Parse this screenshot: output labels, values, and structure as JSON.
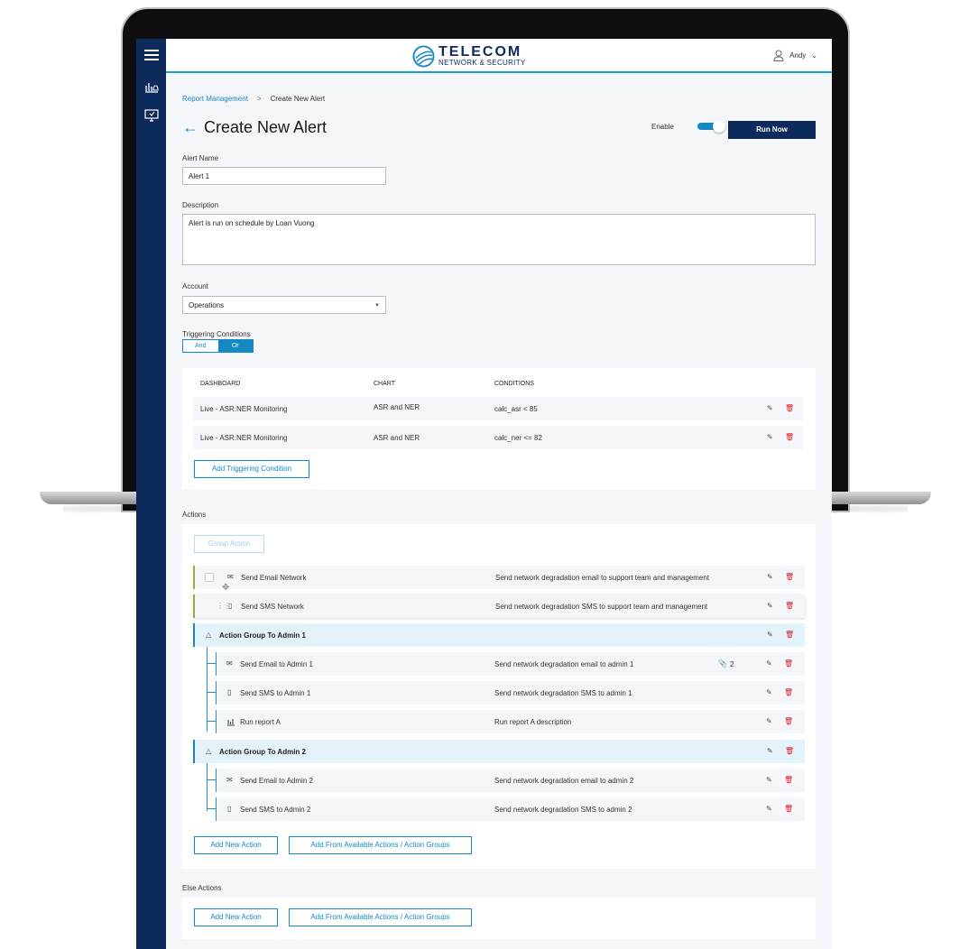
{
  "header": {
    "brand_main": "TELECOM",
    "brand_sub": "NETWORK & SECURITY",
    "user_name": "Andy"
  },
  "sidebar": {
    "items": [
      {
        "icon": "hamburger-menu-icon"
      },
      {
        "icon": "dashboard-bell-icon"
      },
      {
        "icon": "monitor-alert-icon"
      }
    ]
  },
  "breadcrumb": {
    "parent": "Report Management",
    "separator": ">",
    "current": "Create New Alert"
  },
  "page": {
    "back_icon": "arrow-left-icon",
    "title": "Create New Alert",
    "enable_label": "Enable",
    "enable_on": true,
    "run_now_label": "Run Now"
  },
  "form": {
    "alert_name_label": "Alert Name",
    "alert_name_value": "Alert 1",
    "description_label": "Description",
    "description_value": "Alert is run on schedule by Loan Vuong",
    "account_label": "Account",
    "account_value": "Operations",
    "triggering_label": "Triggering Conditions",
    "logic_and": "And",
    "logic_or": "Or",
    "logic_selected": "Or"
  },
  "conditions": {
    "headers": {
      "dashboard": "DASHBOARD",
      "chart": "CHART",
      "conditions": "CONDITIONS"
    },
    "rows": [
      {
        "dashboard": "Live - ASR:NER Monitoring",
        "chart": "ASR and NER",
        "condition": "calc_asr < 85"
      },
      {
        "dashboard": "Live - ASR:NER Monitoring",
        "chart": "ASR and NER",
        "condition": "calc_ner <= 82"
      }
    ],
    "add_label": "Add Triggering Condition"
  },
  "actions": {
    "section_label": "Actions",
    "group_action_label": "Group Action",
    "items": [
      {
        "name": "Send Email Network",
        "desc": "Send network degradation email to support team and management",
        "icon": "mail-icon"
      },
      {
        "name": "Send SMS Network",
        "desc": "Send network degradation SMS to support team and management",
        "icon": "phone-icon"
      }
    ],
    "groups": [
      {
        "name": "Action Group To Admin 1",
        "icon": "group-tree-icon",
        "children": [
          {
            "name": "Send Email to Admin 1",
            "desc": "Send network degradation email to admin 1",
            "icon": "mail-icon",
            "attachments": "2"
          },
          {
            "name": "Send SMS to Admin 1",
            "desc": "Send network degradation SMS to admin 1",
            "icon": "phone-icon"
          },
          {
            "name": "Run report A",
            "desc": "Run report A description",
            "icon": "report-chart-icon"
          }
        ]
      },
      {
        "name": "Action Group To Admin 2",
        "icon": "group-tree-icon",
        "children": [
          {
            "name": "Send Email to Admin 2",
            "desc": "Send network degradation email to admin 2",
            "icon": "mail-icon"
          },
          {
            "name": "Send SMS to Admin 2",
            "desc": "Send network degradation SMS to admin 2",
            "icon": "phone-icon"
          }
        ]
      }
    ],
    "add_new_label": "Add New Action",
    "add_from_label": "Add From Available Actions / Action Groups"
  },
  "else_actions": {
    "section_label": "Else Actions",
    "add_new_label": "Add New Action",
    "add_from_label": "Add From Available Actions / Action Groups"
  },
  "colors": {
    "navy": "#0d2a5c",
    "accent": "#1689c5",
    "delete": "#d8232a",
    "row_bg": "#f5f6fa",
    "group_bg": "#e4f3fa",
    "action_marker": "#8ab43f"
  }
}
